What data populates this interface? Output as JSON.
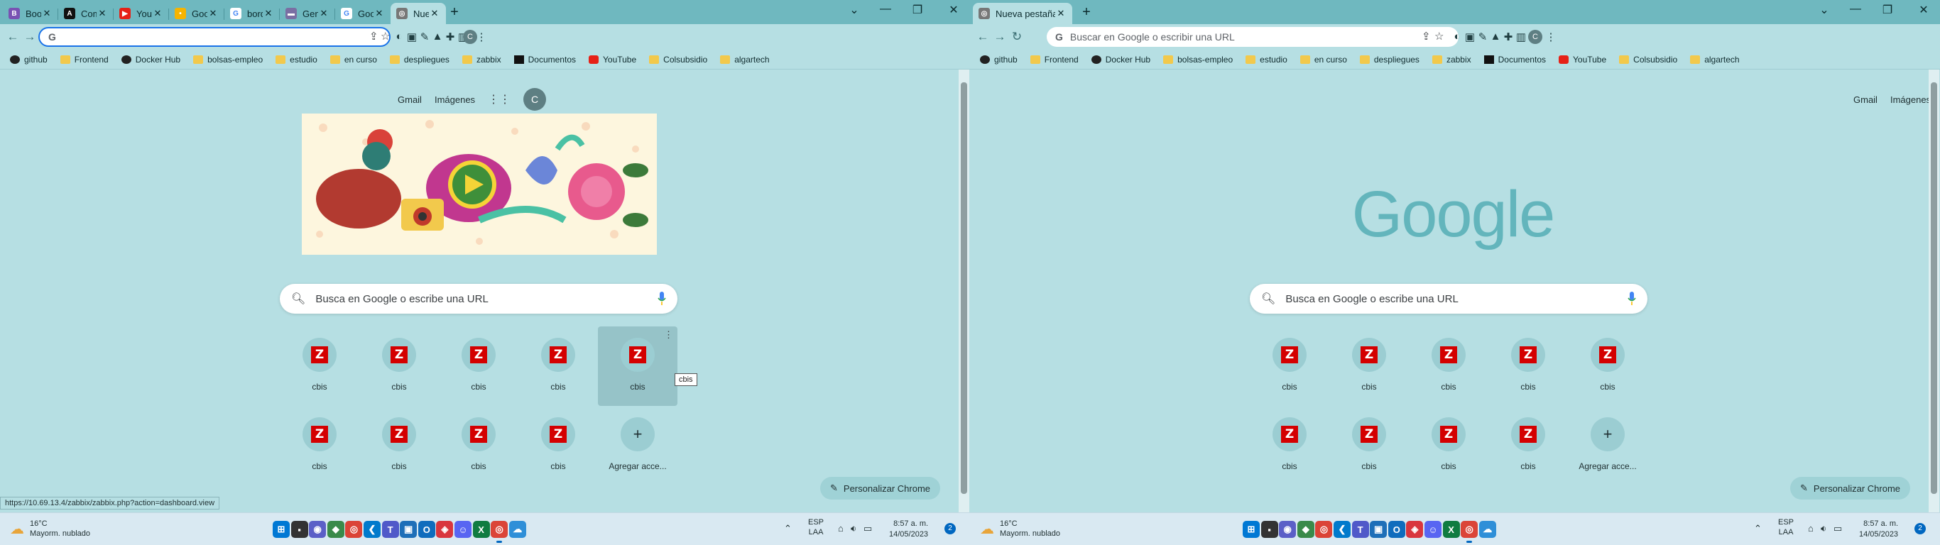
{
  "left": {
    "tabs": [
      {
        "title": "Bootstrap ico",
        "favicon": "bootstrap-icon",
        "color": "#7952b3",
        "glyph": "B"
      },
      {
        "title": "Como Centrar",
        "favicon": "angular-icon",
        "color": "#111111",
        "glyph": "A"
      },
      {
        "title": "YouTube",
        "favicon": "youtube-icon",
        "color": "#e62117",
        "glyph": "▶"
      },
      {
        "title": "Google Keep",
        "favicon": "keep-icon",
        "color": "#f6b400",
        "glyph": "•"
      },
      {
        "title": "bordes css pa",
        "favicon": "google-icon",
        "color": "#ffffff",
        "glyph": "G"
      },
      {
        "title": "Generator de",
        "favicon": "generator-icon",
        "color": "#7a6fa3",
        "glyph": "▬"
      },
      {
        "title": "Google Clon",
        "favicon": "google-icon",
        "color": "#ffffff",
        "glyph": "G"
      },
      {
        "title": "Nueva pestañ",
        "favicon": "chrome-icon",
        "color": "#777777",
        "glyph": "◎"
      }
    ],
    "omnibox_value": "",
    "status_url": "https://10.69.13.4/zabbix/zabbix.php?action=dashboard.view",
    "tooltip": "cbis"
  },
  "right": {
    "tabs": [
      {
        "title": "Nueva pestaña",
        "favicon": "chrome-icon",
        "color": "#777777",
        "glyph": "◎"
      }
    ],
    "omnibox_placeholder": "Buscar en Google o escribir una URL",
    "logo": "Google"
  },
  "bookmarks": [
    {
      "label": "github",
      "icon": "github-icon",
      "kind": "round"
    },
    {
      "label": "Frontend",
      "icon": "folder-icon",
      "kind": "folder"
    },
    {
      "label": "Docker Hub",
      "icon": "docker-icon",
      "kind": "round"
    },
    {
      "label": "bolsas-empleo",
      "icon": "folder-icon",
      "kind": "folder"
    },
    {
      "label": "estudio",
      "icon": "folder-icon",
      "kind": "folder"
    },
    {
      "label": "en curso",
      "icon": "folder-icon",
      "kind": "folder"
    },
    {
      "label": "despliegues",
      "icon": "folder-icon",
      "kind": "folder"
    },
    {
      "label": "zabbix",
      "icon": "folder-icon",
      "kind": "folder"
    },
    {
      "label": "Documentos",
      "icon": "notion-icon",
      "kind": "doc"
    },
    {
      "label": "YouTube",
      "icon": "youtube-icon",
      "kind": "yt"
    },
    {
      "label": "Colsubsidio",
      "icon": "folder-icon",
      "kind": "folder"
    },
    {
      "label": "algartech",
      "icon": "folder-icon",
      "kind": "folder"
    }
  ],
  "ntp": {
    "gmail": "Gmail",
    "images": "Imágenes",
    "avatar": "C",
    "search_placeholder": "Busca en Google o escribe una URL",
    "customize": "Personalizar Chrome",
    "shortcuts": [
      {
        "label": "cbis",
        "type": "zabbix"
      },
      {
        "label": "cbis",
        "type": "zabbix"
      },
      {
        "label": "cbis",
        "type": "zabbix"
      },
      {
        "label": "cbis",
        "type": "zabbix"
      },
      {
        "label": "cbis",
        "type": "zabbix"
      },
      {
        "label": "cbis",
        "type": "zabbix"
      },
      {
        "label": "cbis",
        "type": "zabbix"
      },
      {
        "label": "cbis",
        "type": "zabbix"
      },
      {
        "label": "cbis",
        "type": "zabbix"
      },
      {
        "label": "Agregar acce...",
        "type": "add"
      }
    ]
  },
  "taskbar": {
    "temp": "16°C",
    "weather": "Mayorm. nublado",
    "lang1": "ESP",
    "lang2": "LAA",
    "time": "8:57 a. m.",
    "date": "14/05/2023",
    "notifications": "2",
    "apps": [
      {
        "name": "windows-start-icon",
        "color": "#0078d4",
        "glyph": "⊞"
      },
      {
        "name": "file-explorer-icon",
        "color": "#333333",
        "glyph": "▪"
      },
      {
        "name": "teams-chat-icon",
        "color": "#5b5fc7",
        "glyph": "◉"
      },
      {
        "name": "edge-dev-icon",
        "color": "#3a8a4a",
        "glyph": "◆"
      },
      {
        "name": "chrome-icon",
        "color": "#db4437",
        "glyph": "◎"
      },
      {
        "name": "vscode-icon",
        "color": "#007acc",
        "glyph": "❮"
      },
      {
        "name": "teams-icon",
        "color": "#5059c9",
        "glyph": "T"
      },
      {
        "name": "vpn-icon",
        "color": "#1e6fb8",
        "glyph": "▣"
      },
      {
        "name": "outlook-icon",
        "color": "#0f6cbd",
        "glyph": "O"
      },
      {
        "name": "anydesk-icon",
        "color": "#d9363e",
        "glyph": "◈"
      },
      {
        "name": "discord-icon",
        "color": "#5865f2",
        "glyph": "☺"
      },
      {
        "name": "excel-icon",
        "color": "#107c41",
        "glyph": "X"
      },
      {
        "name": "chrome-profile-icon",
        "color": "#db4437",
        "glyph": "◎"
      },
      {
        "name": "weather-app-icon",
        "color": "#2f8fd8",
        "glyph": "☁"
      }
    ]
  }
}
